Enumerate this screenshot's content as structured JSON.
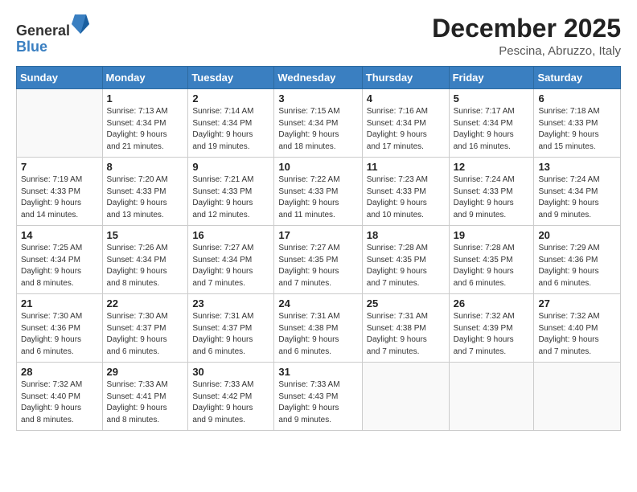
{
  "logo": {
    "general": "General",
    "blue": "Blue"
  },
  "title": "December 2025",
  "location": "Pescina, Abruzzo, Italy",
  "days_of_week": [
    "Sunday",
    "Monday",
    "Tuesday",
    "Wednesday",
    "Thursday",
    "Friday",
    "Saturday"
  ],
  "weeks": [
    [
      {
        "day": "",
        "info": ""
      },
      {
        "day": "1",
        "info": "Sunrise: 7:13 AM\nSunset: 4:34 PM\nDaylight: 9 hours\nand 21 minutes."
      },
      {
        "day": "2",
        "info": "Sunrise: 7:14 AM\nSunset: 4:34 PM\nDaylight: 9 hours\nand 19 minutes."
      },
      {
        "day": "3",
        "info": "Sunrise: 7:15 AM\nSunset: 4:34 PM\nDaylight: 9 hours\nand 18 minutes."
      },
      {
        "day": "4",
        "info": "Sunrise: 7:16 AM\nSunset: 4:34 PM\nDaylight: 9 hours\nand 17 minutes."
      },
      {
        "day": "5",
        "info": "Sunrise: 7:17 AM\nSunset: 4:34 PM\nDaylight: 9 hours\nand 16 minutes."
      },
      {
        "day": "6",
        "info": "Sunrise: 7:18 AM\nSunset: 4:33 PM\nDaylight: 9 hours\nand 15 minutes."
      }
    ],
    [
      {
        "day": "7",
        "info": "Sunrise: 7:19 AM\nSunset: 4:33 PM\nDaylight: 9 hours\nand 14 minutes."
      },
      {
        "day": "8",
        "info": "Sunrise: 7:20 AM\nSunset: 4:33 PM\nDaylight: 9 hours\nand 13 minutes."
      },
      {
        "day": "9",
        "info": "Sunrise: 7:21 AM\nSunset: 4:33 PM\nDaylight: 9 hours\nand 12 minutes."
      },
      {
        "day": "10",
        "info": "Sunrise: 7:22 AM\nSunset: 4:33 PM\nDaylight: 9 hours\nand 11 minutes."
      },
      {
        "day": "11",
        "info": "Sunrise: 7:23 AM\nSunset: 4:33 PM\nDaylight: 9 hours\nand 10 minutes."
      },
      {
        "day": "12",
        "info": "Sunrise: 7:24 AM\nSunset: 4:33 PM\nDaylight: 9 hours\nand 9 minutes."
      },
      {
        "day": "13",
        "info": "Sunrise: 7:24 AM\nSunset: 4:34 PM\nDaylight: 9 hours\nand 9 minutes."
      }
    ],
    [
      {
        "day": "14",
        "info": "Sunrise: 7:25 AM\nSunset: 4:34 PM\nDaylight: 9 hours\nand 8 minutes."
      },
      {
        "day": "15",
        "info": "Sunrise: 7:26 AM\nSunset: 4:34 PM\nDaylight: 9 hours\nand 8 minutes."
      },
      {
        "day": "16",
        "info": "Sunrise: 7:27 AM\nSunset: 4:34 PM\nDaylight: 9 hours\nand 7 minutes."
      },
      {
        "day": "17",
        "info": "Sunrise: 7:27 AM\nSunset: 4:35 PM\nDaylight: 9 hours\nand 7 minutes."
      },
      {
        "day": "18",
        "info": "Sunrise: 7:28 AM\nSunset: 4:35 PM\nDaylight: 9 hours\nand 7 minutes."
      },
      {
        "day": "19",
        "info": "Sunrise: 7:28 AM\nSunset: 4:35 PM\nDaylight: 9 hours\nand 6 minutes."
      },
      {
        "day": "20",
        "info": "Sunrise: 7:29 AM\nSunset: 4:36 PM\nDaylight: 9 hours\nand 6 minutes."
      }
    ],
    [
      {
        "day": "21",
        "info": "Sunrise: 7:30 AM\nSunset: 4:36 PM\nDaylight: 9 hours\nand 6 minutes."
      },
      {
        "day": "22",
        "info": "Sunrise: 7:30 AM\nSunset: 4:37 PM\nDaylight: 9 hours\nand 6 minutes."
      },
      {
        "day": "23",
        "info": "Sunrise: 7:31 AM\nSunset: 4:37 PM\nDaylight: 9 hours\nand 6 minutes."
      },
      {
        "day": "24",
        "info": "Sunrise: 7:31 AM\nSunset: 4:38 PM\nDaylight: 9 hours\nand 6 minutes."
      },
      {
        "day": "25",
        "info": "Sunrise: 7:31 AM\nSunset: 4:38 PM\nDaylight: 9 hours\nand 7 minutes."
      },
      {
        "day": "26",
        "info": "Sunrise: 7:32 AM\nSunset: 4:39 PM\nDaylight: 9 hours\nand 7 minutes."
      },
      {
        "day": "27",
        "info": "Sunrise: 7:32 AM\nSunset: 4:40 PM\nDaylight: 9 hours\nand 7 minutes."
      }
    ],
    [
      {
        "day": "28",
        "info": "Sunrise: 7:32 AM\nSunset: 4:40 PM\nDaylight: 9 hours\nand 8 minutes."
      },
      {
        "day": "29",
        "info": "Sunrise: 7:33 AM\nSunset: 4:41 PM\nDaylight: 9 hours\nand 8 minutes."
      },
      {
        "day": "30",
        "info": "Sunrise: 7:33 AM\nSunset: 4:42 PM\nDaylight: 9 hours\nand 9 minutes."
      },
      {
        "day": "31",
        "info": "Sunrise: 7:33 AM\nSunset: 4:43 PM\nDaylight: 9 hours\nand 9 minutes."
      },
      {
        "day": "",
        "info": ""
      },
      {
        "day": "",
        "info": ""
      },
      {
        "day": "",
        "info": ""
      }
    ]
  ]
}
